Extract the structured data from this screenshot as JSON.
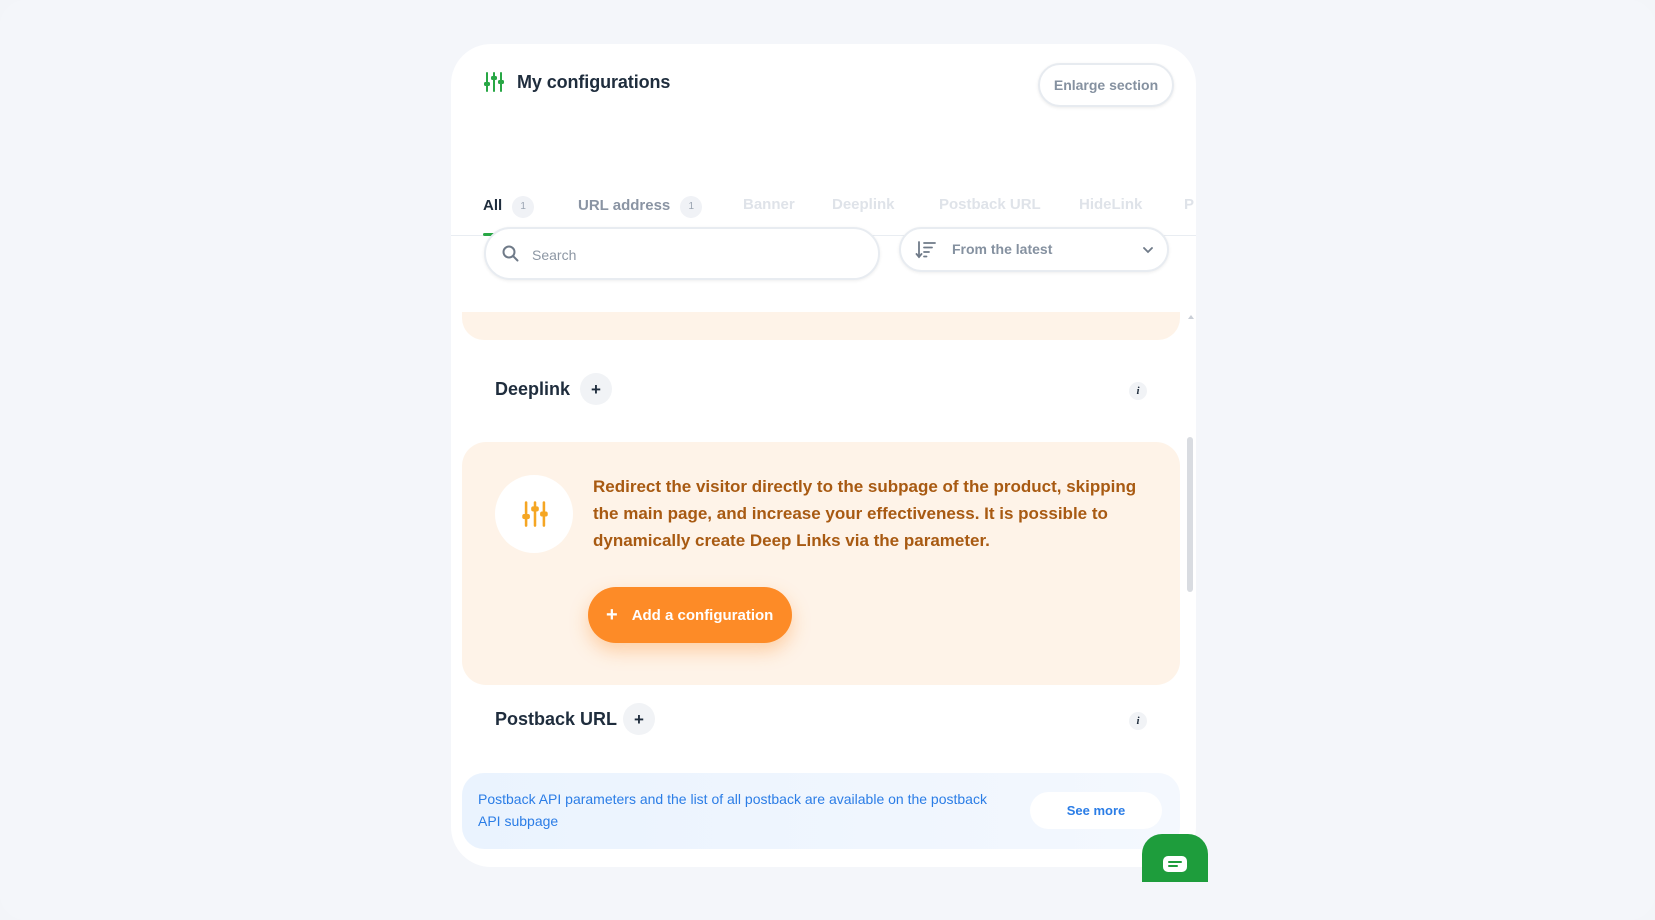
{
  "header": {
    "title": "My configurations",
    "enlarge_label": "Enlarge section"
  },
  "tabs": [
    {
      "label": "All",
      "count": "1",
      "state": "active"
    },
    {
      "label": "URL address",
      "count": "1",
      "state": "normal"
    },
    {
      "label": "Banner",
      "state": "faded"
    },
    {
      "label": "Deeplink",
      "state": "faded"
    },
    {
      "label": "Postback URL",
      "state": "faded"
    },
    {
      "label": "HideLink",
      "state": "faded"
    },
    {
      "label": "P",
      "state": "faded"
    }
  ],
  "toolbar": {
    "search_placeholder": "Search",
    "search_value": "",
    "sort_selected": "From the latest"
  },
  "sections": {
    "deeplink": {
      "title": "Deeplink",
      "add_symbol": "+",
      "info_symbol": "i",
      "description": "Redirect the visitor directly to the subpage of the product, skipping the main page, and increase your effectiveness. It is possible to dynamically create Deep Links via the parameter.",
      "add_button_label": "Add a configuration",
      "add_button_symbol": "+"
    },
    "postback": {
      "title": "Postback URL",
      "add_symbol": "+",
      "info_symbol": "i",
      "notice": "Postback API parameters and the list of all postback are available on the postback",
      "notice_link": "API subpage",
      "see_more_label": "See more"
    }
  },
  "colors": {
    "accent_green": "#28a745",
    "accent_orange": "#fd8b27",
    "deeplink_text": "#a85a12",
    "deeplink_bg": "#fef3e8",
    "postback_text": "#2b7de6",
    "chat_green": "#1e9d3c"
  },
  "icons": {
    "header": "sliders-icon",
    "search": "search-icon",
    "sort": "sort-descending-icon",
    "dropdown": "chevron-down-icon",
    "deeplink": "sliders-icon",
    "chat": "chat-bubble-icon"
  }
}
